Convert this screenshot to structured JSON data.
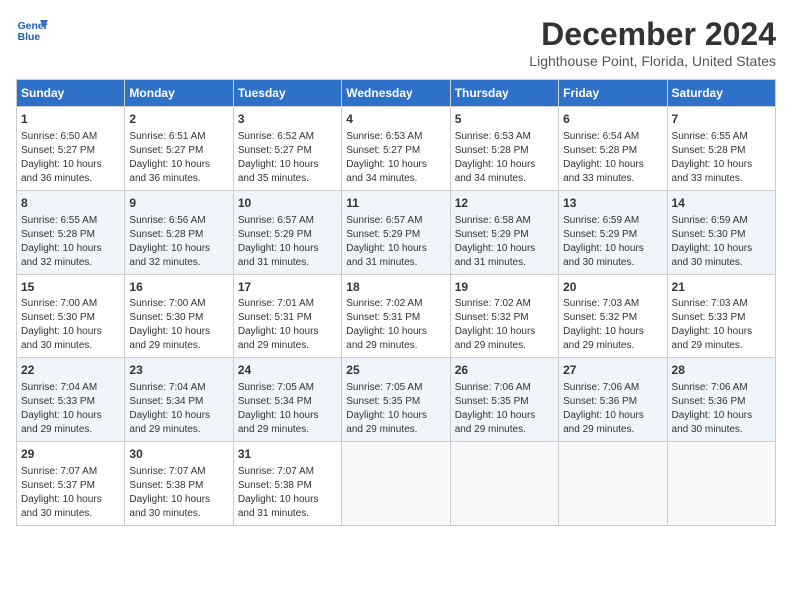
{
  "header": {
    "logo_line1": "General",
    "logo_line2": "Blue",
    "month": "December 2024",
    "location": "Lighthouse Point, Florida, United States"
  },
  "days_of_week": [
    "Sunday",
    "Monday",
    "Tuesday",
    "Wednesday",
    "Thursday",
    "Friday",
    "Saturday"
  ],
  "weeks": [
    [
      {
        "day": "1",
        "info": "Sunrise: 6:50 AM\nSunset: 5:27 PM\nDaylight: 10 hours\nand 36 minutes."
      },
      {
        "day": "2",
        "info": "Sunrise: 6:51 AM\nSunset: 5:27 PM\nDaylight: 10 hours\nand 36 minutes."
      },
      {
        "day": "3",
        "info": "Sunrise: 6:52 AM\nSunset: 5:27 PM\nDaylight: 10 hours\nand 35 minutes."
      },
      {
        "day": "4",
        "info": "Sunrise: 6:53 AM\nSunset: 5:27 PM\nDaylight: 10 hours\nand 34 minutes."
      },
      {
        "day": "5",
        "info": "Sunrise: 6:53 AM\nSunset: 5:28 PM\nDaylight: 10 hours\nand 34 minutes."
      },
      {
        "day": "6",
        "info": "Sunrise: 6:54 AM\nSunset: 5:28 PM\nDaylight: 10 hours\nand 33 minutes."
      },
      {
        "day": "7",
        "info": "Sunrise: 6:55 AM\nSunset: 5:28 PM\nDaylight: 10 hours\nand 33 minutes."
      }
    ],
    [
      {
        "day": "8",
        "info": "Sunrise: 6:55 AM\nSunset: 5:28 PM\nDaylight: 10 hours\nand 32 minutes."
      },
      {
        "day": "9",
        "info": "Sunrise: 6:56 AM\nSunset: 5:28 PM\nDaylight: 10 hours\nand 32 minutes."
      },
      {
        "day": "10",
        "info": "Sunrise: 6:57 AM\nSunset: 5:29 PM\nDaylight: 10 hours\nand 31 minutes."
      },
      {
        "day": "11",
        "info": "Sunrise: 6:57 AM\nSunset: 5:29 PM\nDaylight: 10 hours\nand 31 minutes."
      },
      {
        "day": "12",
        "info": "Sunrise: 6:58 AM\nSunset: 5:29 PM\nDaylight: 10 hours\nand 31 minutes."
      },
      {
        "day": "13",
        "info": "Sunrise: 6:59 AM\nSunset: 5:29 PM\nDaylight: 10 hours\nand 30 minutes."
      },
      {
        "day": "14",
        "info": "Sunrise: 6:59 AM\nSunset: 5:30 PM\nDaylight: 10 hours\nand 30 minutes."
      }
    ],
    [
      {
        "day": "15",
        "info": "Sunrise: 7:00 AM\nSunset: 5:30 PM\nDaylight: 10 hours\nand 30 minutes."
      },
      {
        "day": "16",
        "info": "Sunrise: 7:00 AM\nSunset: 5:30 PM\nDaylight: 10 hours\nand 29 minutes."
      },
      {
        "day": "17",
        "info": "Sunrise: 7:01 AM\nSunset: 5:31 PM\nDaylight: 10 hours\nand 29 minutes."
      },
      {
        "day": "18",
        "info": "Sunrise: 7:02 AM\nSunset: 5:31 PM\nDaylight: 10 hours\nand 29 minutes."
      },
      {
        "day": "19",
        "info": "Sunrise: 7:02 AM\nSunset: 5:32 PM\nDaylight: 10 hours\nand 29 minutes."
      },
      {
        "day": "20",
        "info": "Sunrise: 7:03 AM\nSunset: 5:32 PM\nDaylight: 10 hours\nand 29 minutes."
      },
      {
        "day": "21",
        "info": "Sunrise: 7:03 AM\nSunset: 5:33 PM\nDaylight: 10 hours\nand 29 minutes."
      }
    ],
    [
      {
        "day": "22",
        "info": "Sunrise: 7:04 AM\nSunset: 5:33 PM\nDaylight: 10 hours\nand 29 minutes."
      },
      {
        "day": "23",
        "info": "Sunrise: 7:04 AM\nSunset: 5:34 PM\nDaylight: 10 hours\nand 29 minutes."
      },
      {
        "day": "24",
        "info": "Sunrise: 7:05 AM\nSunset: 5:34 PM\nDaylight: 10 hours\nand 29 minutes."
      },
      {
        "day": "25",
        "info": "Sunrise: 7:05 AM\nSunset: 5:35 PM\nDaylight: 10 hours\nand 29 minutes."
      },
      {
        "day": "26",
        "info": "Sunrise: 7:06 AM\nSunset: 5:35 PM\nDaylight: 10 hours\nand 29 minutes."
      },
      {
        "day": "27",
        "info": "Sunrise: 7:06 AM\nSunset: 5:36 PM\nDaylight: 10 hours\nand 29 minutes."
      },
      {
        "day": "28",
        "info": "Sunrise: 7:06 AM\nSunset: 5:36 PM\nDaylight: 10 hours\nand 30 minutes."
      }
    ],
    [
      {
        "day": "29",
        "info": "Sunrise: 7:07 AM\nSunset: 5:37 PM\nDaylight: 10 hours\nand 30 minutes."
      },
      {
        "day": "30",
        "info": "Sunrise: 7:07 AM\nSunset: 5:38 PM\nDaylight: 10 hours\nand 30 minutes."
      },
      {
        "day": "31",
        "info": "Sunrise: 7:07 AM\nSunset: 5:38 PM\nDaylight: 10 hours\nand 31 minutes."
      },
      {
        "day": "",
        "info": ""
      },
      {
        "day": "",
        "info": ""
      },
      {
        "day": "",
        "info": ""
      },
      {
        "day": "",
        "info": ""
      }
    ]
  ]
}
